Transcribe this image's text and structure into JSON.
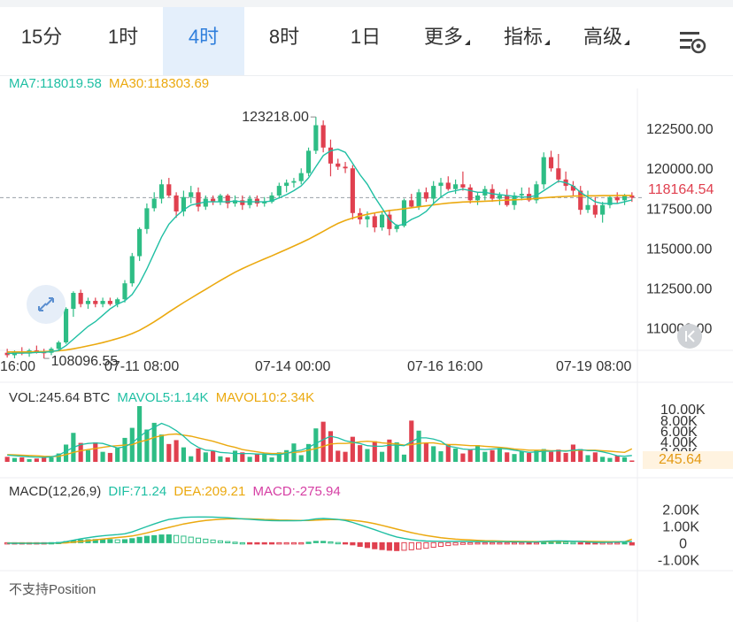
{
  "tabs": [
    {
      "label": "15分",
      "active": false
    },
    {
      "label": "1时",
      "active": false
    },
    {
      "label": "4时",
      "active": true
    },
    {
      "label": "8时",
      "active": false
    },
    {
      "label": "1日",
      "active": false
    },
    {
      "label": "更多",
      "active": false,
      "dropdown": true
    },
    {
      "label": "指标",
      "active": false,
      "dropdown": true
    },
    {
      "label": "高级",
      "active": false,
      "dropdown": true
    }
  ],
  "settings_icon": "chart-settings-icon",
  "colors": {
    "up": "#2ebd85",
    "down": "#e0404f",
    "ma7": "#1fbfa3",
    "ma30": "#eba90f",
    "active_tab_bg": "#e4effb",
    "active_tab_text": "#2f7fdc"
  },
  "legend": {
    "ma7": "MA7:118019.58",
    "ma30": "MA30:118303.69"
  },
  "vol_legend": {
    "vol": "VOL:245.64 BTC",
    "mavol5": "MAVOL5:1.14K",
    "mavol10": "MAVOL10:2.34K"
  },
  "macd_legend": {
    "params": "MACD(12,26,9)",
    "dif": "DIF:71.24",
    "dea": "DEA:209.21",
    "macd": "MACD:-275.94"
  },
  "position_text": "不支持Position",
  "current_price": "118164.54",
  "current_volume": "245.64",
  "expand_icon": "expand-icon",
  "back_icon": "scroll-to-latest-icon",
  "chart_data": {
    "type": "candlestick",
    "interval": "4h",
    "price_axis": {
      "ticks": [
        "122500.00",
        "120000.00",
        "117500.00",
        "115000.00",
        "112500.00",
        "110000.00"
      ],
      "tick_values": [
        122500,
        120000,
        117500,
        115000,
        112500,
        110000
      ],
      "range": [
        108600,
        125000
      ]
    },
    "time_axis": {
      "ticks": [
        "16:00",
        "07-11 08:00",
        "07-14 00:00",
        "07-16 16:00",
        "07-19 08:00"
      ]
    },
    "annotations": {
      "high_label": "123218.00",
      "high_value": 123218,
      "low_label": "108096.55",
      "low_value": 108096.55
    },
    "candles_ohlc": [
      [
        108450,
        108700,
        108150,
        108300
      ],
      [
        108300,
        108600,
        108100,
        108500
      ],
      [
        108500,
        108800,
        108300,
        108400
      ],
      [
        108400,
        108700,
        108200,
        108600
      ],
      [
        108600,
        108900,
        108400,
        108500
      ],
      [
        108500,
        108700,
        108096.55,
        108450
      ],
      [
        108450,
        108800,
        108300,
        108700
      ],
      [
        108700,
        109200,
        108600,
        109100
      ],
      [
        109100,
        111300,
        109000,
        111200
      ],
      [
        111200,
        112300,
        110700,
        112200
      ],
      [
        112200,
        112400,
        111300,
        111500
      ],
      [
        111500,
        111900,
        111200,
        111700
      ],
      [
        111700,
        111900,
        111300,
        111500
      ],
      [
        111500,
        111900,
        111300,
        111700
      ],
      [
        111700,
        111900,
        111400,
        111500
      ],
      [
        111500,
        111900,
        111300,
        111800
      ],
      [
        111800,
        113000,
        111600,
        112800
      ],
      [
        112800,
        114700,
        112600,
        114500
      ],
      [
        114500,
        116300,
        114200,
        116200
      ],
      [
        116200,
        117800,
        115900,
        117500
      ],
      [
        117500,
        118500,
        117300,
        118100
      ],
      [
        118100,
        119300,
        117800,
        119000
      ],
      [
        119000,
        119400,
        118200,
        118300
      ],
      [
        118300,
        118500,
        116900,
        117300
      ],
      [
        117300,
        118600,
        117000,
        118200
      ],
      [
        118200,
        118900,
        117800,
        118500
      ],
      [
        118500,
        118800,
        117300,
        117600
      ],
      [
        117600,
        118300,
        117400,
        118100
      ],
      [
        118100,
        118300,
        117700,
        117900
      ],
      [
        117900,
        118400,
        117700,
        118300
      ],
      [
        118300,
        118400,
        117500,
        117800
      ],
      [
        117800,
        118300,
        117600,
        118000
      ],
      [
        118000,
        118300,
        117400,
        117700
      ],
      [
        117700,
        118300,
        117500,
        118100
      ],
      [
        118100,
        118300,
        117600,
        117800
      ],
      [
        117800,
        118200,
        117600,
        117900
      ],
      [
        117900,
        118500,
        117800,
        118300
      ],
      [
        118300,
        119100,
        118100,
        118900
      ],
      [
        118900,
        119300,
        118500,
        119100
      ],
      [
        119100,
        119400,
        118800,
        119200
      ],
      [
        119200,
        120000,
        119000,
        119700
      ],
      [
        119700,
        121300,
        119500,
        121100
      ],
      [
        121100,
        123218,
        120900,
        122700
      ],
      [
        122700,
        123000,
        121000,
        121300
      ],
      [
        121300,
        121800,
        119500,
        120300
      ],
      [
        120300,
        120600,
        119900,
        120100
      ],
      [
        120100,
        120400,
        119700,
        120000
      ],
      [
        120000,
        120200,
        116800,
        117200
      ],
      [
        117200,
        117500,
        116500,
        116800
      ],
      [
        116800,
        117300,
        116300,
        117000
      ],
      [
        117000,
        117200,
        116000,
        116300
      ],
      [
        116300,
        117300,
        116100,
        117100
      ],
      [
        117100,
        117400,
        115800,
        116200
      ],
      [
        116200,
        116500,
        116000,
        116400
      ],
      [
        116400,
        118100,
        116300,
        118000
      ],
      [
        118000,
        118400,
        117500,
        117600
      ],
      [
        117600,
        118700,
        117400,
        118500
      ],
      [
        118500,
        118800,
        117900,
        118100
      ],
      [
        118100,
        119200,
        117800,
        118900
      ],
      [
        118900,
        119400,
        118200,
        119100
      ],
      [
        119100,
        119500,
        118600,
        118700
      ],
      [
        118700,
        119300,
        118400,
        119000
      ],
      [
        119000,
        119800,
        118600,
        118800
      ],
      [
        118800,
        119000,
        117800,
        118000
      ],
      [
        118000,
        118500,
        117700,
        118300
      ],
      [
        118300,
        118900,
        118000,
        118700
      ],
      [
        118700,
        119000,
        117900,
        118100
      ],
      [
        118100,
        118500,
        117700,
        118300
      ],
      [
        118300,
        118700,
        117600,
        117700
      ],
      [
        117700,
        118500,
        117400,
        118300
      ],
      [
        118300,
        118800,
        118000,
        118400
      ],
      [
        118400,
        118800,
        117900,
        118000
      ],
      [
        118000,
        119200,
        117800,
        119000
      ],
      [
        119000,
        121000,
        118700,
        120700
      ],
      [
        120700,
        121100,
        119800,
        120000
      ],
      [
        120000,
        120900,
        119100,
        119300
      ],
      [
        119300,
        119800,
        118600,
        118900
      ],
      [
        118900,
        119200,
        118300,
        118600
      ],
      [
        118600,
        118900,
        117100,
        117400
      ],
      [
        117400,
        118600,
        117200,
        117700
      ],
      [
        117700,
        118200,
        116900,
        117100
      ],
      [
        117100,
        117900,
        116600,
        117700
      ],
      [
        117700,
        118300,
        117500,
        118200
      ],
      [
        118200,
        118500,
        117800,
        118000
      ],
      [
        118000,
        118400,
        117700,
        118300
      ],
      [
        118300,
        118500,
        117900,
        118164.54
      ]
    ],
    "ma7": [
      108400,
      108420,
      108430,
      108440,
      108470,
      108480,
      108520,
      108600,
      108900,
      109300,
      109700,
      110100,
      110400,
      110800,
      111200,
      111500,
      111700,
      112100,
      112800,
      113700,
      114700,
      115700,
      116500,
      117000,
      117400,
      117700,
      117800,
      117900,
      117900,
      117900,
      117900,
      117950,
      117900,
      117900,
      117900,
      117900,
      117950,
      118150,
      118350,
      118600,
      118900,
      119400,
      120100,
      120800,
      121100,
      121200,
      121000,
      120300,
      119600,
      119000,
      118200,
      117500,
      116800,
      116400,
      116500,
      116800,
      117000,
      117300,
      117800,
      118200,
      118500,
      118600,
      118700,
      118600,
      118500,
      118500,
      118400,
      118350,
      118300,
      118250,
      118200,
      118200,
      118300,
      118600,
      118900,
      119200,
      119100,
      118900,
      118500,
      118200,
      117900,
      117800,
      117800,
      117800,
      117900,
      118019.58
    ],
    "ma30": [
      108500,
      108500,
      108500,
      108500,
      108510,
      108520,
      108540,
      108570,
      108620,
      108700,
      108790,
      108880,
      108980,
      109090,
      109210,
      109340,
      109480,
      109650,
      109860,
      110110,
      110390,
      110690,
      111000,
      111300,
      111590,
      111870,
      112150,
      112420,
      112700,
      112970,
      113240,
      113490,
      113720,
      113930,
      114130,
      114330,
      114520,
      114720,
      114920,
      115130,
      115340,
      115560,
      115800,
      116060,
      116310,
      116550,
      116740,
      116890,
      117010,
      117120,
      117210,
      117290,
      117360,
      117410,
      117470,
      117530,
      117590,
      117650,
      117710,
      117770,
      117820,
      117860,
      117890,
      117900,
      117920,
      117940,
      117960,
      117990,
      118010,
      118030,
      118050,
      118080,
      118110,
      118150,
      118190,
      118220,
      118240,
      118260,
      118270,
      118280,
      118280,
      118290,
      118290,
      118300,
      118300,
      118303.69
    ],
    "volume_axis": {
      "ticks": [
        "10.00K",
        "8.00K",
        "6.00K",
        "4.00K",
        "2.00K"
      ],
      "range": [
        0,
        10000
      ],
      "unit": "BTC"
    },
    "volumes": [
      900,
      700,
      800,
      500,
      600,
      900,
      800,
      1500,
      3100,
      5200,
      3400,
      2100,
      3500,
      1800,
      1600,
      2500,
      4300,
      6100,
      10000,
      5800,
      7000,
      4900,
      3200,
      3900,
      2600,
      1000,
      2400,
      1700,
      1900,
      1000,
      800,
      2000,
      1700,
      900,
      1500,
      1400,
      800,
      1700,
      2100,
      3300,
      1200,
      3200,
      6000,
      7200,
      5500,
      2000,
      1800,
      4500,
      3000,
      2300,
      3700,
      1800,
      4000,
      3500,
      1300,
      7400,
      5600,
      3400,
      2800,
      1900,
      3100,
      2400,
      1500,
      2200,
      3000,
      1800,
      2100,
      2500,
      1700,
      1400,
      1900,
      1600,
      2000,
      2300,
      1800,
      2200,
      1600,
      3100,
      2300,
      1200,
      1700,
      900,
      700,
      1100,
      800,
      245.64
    ],
    "mavol5": [
      1200,
      1100,
      1000,
      900,
      850,
      800,
      900,
      1200,
      1900,
      2600,
      3100,
      3300,
      3400,
      3300,
      2900,
      2500,
      2700,
      3400,
      4500,
      5500,
      6200,
      6900,
      6400,
      5600,
      4600,
      3400,
      2600,
      2100,
      2000,
      1700,
      1600,
      1500,
      1500,
      1500,
      1400,
      1400,
      1300,
      1300,
      1500,
      1900,
      2100,
      2600,
      3300,
      4000,
      4600,
      4300,
      3800,
      3500,
      3300,
      2900,
      2800,
      2800,
      3000,
      3000,
      2900,
      3600,
      4300,
      4300,
      4100,
      3700,
      2800,
      2600,
      2300,
      2200,
      2300,
      2200,
      2300,
      2400,
      2300,
      2100,
      1900,
      1700,
      1800,
      1900,
      1900,
      2000,
      1900,
      2100,
      2200,
      2000,
      2000,
      1800,
      1500,
      1100,
      1000,
      1140
    ],
    "mavol10": [
      1300,
      1250,
      1200,
      1150,
      1100,
      1000,
      950,
      1000,
      1300,
      1700,
      2000,
      2200,
      2400,
      2600,
      2800,
      2900,
      3000,
      3100,
      3600,
      3900,
      4400,
      4700,
      4900,
      5000,
      4800,
      4600,
      4300,
      4000,
      3700,
      3300,
      2900,
      2600,
      2200,
      2000,
      1800,
      1600,
      1500,
      1500,
      1600,
      1700,
      1800,
      2100,
      2400,
      2800,
      3200,
      3300,
      3300,
      3400,
      3600,
      3700,
      3600,
      3400,
      3300,
      3200,
      3000,
      3100,
      3300,
      3400,
      3400,
      3200,
      3100,
      3100,
      3000,
      2900,
      2900,
      2800,
      2700,
      2600,
      2500,
      2300,
      2200,
      2100,
      2100,
      2100,
      2000,
      2000,
      2000,
      2000,
      2100,
      2100,
      2100,
      2000,
      1900,
      1800,
      1700,
      2340
    ],
    "macd_axis": {
      "ticks": [
        "2.00K",
        "1.00K",
        "0",
        "-1.00K"
      ],
      "range": [
        -1400,
        2700
      ]
    },
    "dif": [
      -30,
      -35,
      -40,
      -40,
      -40,
      -35,
      -25,
      -5,
      60,
      150,
      230,
      300,
      360,
      410,
      450,
      480,
      530,
      640,
      800,
      960,
      1110,
      1260,
      1380,
      1440,
      1500,
      1520,
      1530,
      1530,
      1520,
      1500,
      1480,
      1450,
      1420,
      1390,
      1360,
      1330,
      1310,
      1300,
      1300,
      1300,
      1310,
      1350,
      1420,
      1440,
      1420,
      1380,
      1320,
      1200,
      1060,
      920,
      770,
      620,
      470,
      340,
      250,
      180,
      130,
      100,
      90,
      80,
      80,
      80,
      80,
      70,
      70,
      60,
      60,
      60,
      60,
      50,
      50,
      40,
      50,
      80,
      100,
      110,
      100,
      90,
      70,
      40,
      20,
      20,
      30,
      40,
      60,
      71.24
    ],
    "dea": [
      -20,
      -22,
      -25,
      -28,
      -30,
      -31,
      -30,
      -25,
      -10,
      30,
      70,
      120,
      170,
      220,
      260,
      310,
      350,
      400,
      480,
      580,
      690,
      800,
      910,
      1010,
      1110,
      1190,
      1260,
      1320,
      1360,
      1390,
      1410,
      1420,
      1420,
      1410,
      1400,
      1380,
      1370,
      1350,
      1340,
      1330,
      1320,
      1320,
      1340,
      1360,
      1370,
      1370,
      1360,
      1330,
      1280,
      1210,
      1130,
      1030,
      920,
      810,
      700,
      600,
      510,
      430,
      360,
      300,
      250,
      210,
      180,
      160,
      140,
      120,
      110,
      100,
      90,
      80,
      75,
      70,
      65,
      68,
      72,
      78,
      80,
      82,
      80,
      76,
      70,
      64,
      58,
      55,
      56,
      209.21
    ]
  }
}
